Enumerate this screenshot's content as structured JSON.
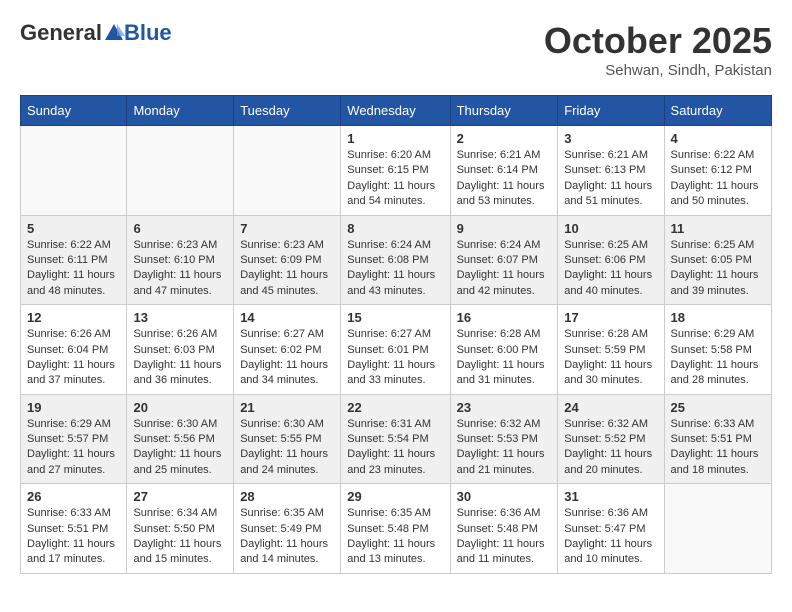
{
  "header": {
    "logo_general": "General",
    "logo_blue": "Blue",
    "month": "October 2025",
    "location": "Sehwan, Sindh, Pakistan"
  },
  "weekdays": [
    "Sunday",
    "Monday",
    "Tuesday",
    "Wednesday",
    "Thursday",
    "Friday",
    "Saturday"
  ],
  "weeks": [
    [
      {
        "day": "",
        "info": ""
      },
      {
        "day": "",
        "info": ""
      },
      {
        "day": "",
        "info": ""
      },
      {
        "day": "1",
        "info": "Sunrise: 6:20 AM\nSunset: 6:15 PM\nDaylight: 11 hours\nand 54 minutes."
      },
      {
        "day": "2",
        "info": "Sunrise: 6:21 AM\nSunset: 6:14 PM\nDaylight: 11 hours\nand 53 minutes."
      },
      {
        "day": "3",
        "info": "Sunrise: 6:21 AM\nSunset: 6:13 PM\nDaylight: 11 hours\nand 51 minutes."
      },
      {
        "day": "4",
        "info": "Sunrise: 6:22 AM\nSunset: 6:12 PM\nDaylight: 11 hours\nand 50 minutes."
      }
    ],
    [
      {
        "day": "5",
        "info": "Sunrise: 6:22 AM\nSunset: 6:11 PM\nDaylight: 11 hours\nand 48 minutes."
      },
      {
        "day": "6",
        "info": "Sunrise: 6:23 AM\nSunset: 6:10 PM\nDaylight: 11 hours\nand 47 minutes."
      },
      {
        "day": "7",
        "info": "Sunrise: 6:23 AM\nSunset: 6:09 PM\nDaylight: 11 hours\nand 45 minutes."
      },
      {
        "day": "8",
        "info": "Sunrise: 6:24 AM\nSunset: 6:08 PM\nDaylight: 11 hours\nand 43 minutes."
      },
      {
        "day": "9",
        "info": "Sunrise: 6:24 AM\nSunset: 6:07 PM\nDaylight: 11 hours\nand 42 minutes."
      },
      {
        "day": "10",
        "info": "Sunrise: 6:25 AM\nSunset: 6:06 PM\nDaylight: 11 hours\nand 40 minutes."
      },
      {
        "day": "11",
        "info": "Sunrise: 6:25 AM\nSunset: 6:05 PM\nDaylight: 11 hours\nand 39 minutes."
      }
    ],
    [
      {
        "day": "12",
        "info": "Sunrise: 6:26 AM\nSunset: 6:04 PM\nDaylight: 11 hours\nand 37 minutes."
      },
      {
        "day": "13",
        "info": "Sunrise: 6:26 AM\nSunset: 6:03 PM\nDaylight: 11 hours\nand 36 minutes."
      },
      {
        "day": "14",
        "info": "Sunrise: 6:27 AM\nSunset: 6:02 PM\nDaylight: 11 hours\nand 34 minutes."
      },
      {
        "day": "15",
        "info": "Sunrise: 6:27 AM\nSunset: 6:01 PM\nDaylight: 11 hours\nand 33 minutes."
      },
      {
        "day": "16",
        "info": "Sunrise: 6:28 AM\nSunset: 6:00 PM\nDaylight: 11 hours\nand 31 minutes."
      },
      {
        "day": "17",
        "info": "Sunrise: 6:28 AM\nSunset: 5:59 PM\nDaylight: 11 hours\nand 30 minutes."
      },
      {
        "day": "18",
        "info": "Sunrise: 6:29 AM\nSunset: 5:58 PM\nDaylight: 11 hours\nand 28 minutes."
      }
    ],
    [
      {
        "day": "19",
        "info": "Sunrise: 6:29 AM\nSunset: 5:57 PM\nDaylight: 11 hours\nand 27 minutes."
      },
      {
        "day": "20",
        "info": "Sunrise: 6:30 AM\nSunset: 5:56 PM\nDaylight: 11 hours\nand 25 minutes."
      },
      {
        "day": "21",
        "info": "Sunrise: 6:30 AM\nSunset: 5:55 PM\nDaylight: 11 hours\nand 24 minutes."
      },
      {
        "day": "22",
        "info": "Sunrise: 6:31 AM\nSunset: 5:54 PM\nDaylight: 11 hours\nand 23 minutes."
      },
      {
        "day": "23",
        "info": "Sunrise: 6:32 AM\nSunset: 5:53 PM\nDaylight: 11 hours\nand 21 minutes."
      },
      {
        "day": "24",
        "info": "Sunrise: 6:32 AM\nSunset: 5:52 PM\nDaylight: 11 hours\nand 20 minutes."
      },
      {
        "day": "25",
        "info": "Sunrise: 6:33 AM\nSunset: 5:51 PM\nDaylight: 11 hours\nand 18 minutes."
      }
    ],
    [
      {
        "day": "26",
        "info": "Sunrise: 6:33 AM\nSunset: 5:51 PM\nDaylight: 11 hours\nand 17 minutes."
      },
      {
        "day": "27",
        "info": "Sunrise: 6:34 AM\nSunset: 5:50 PM\nDaylight: 11 hours\nand 15 minutes."
      },
      {
        "day": "28",
        "info": "Sunrise: 6:35 AM\nSunset: 5:49 PM\nDaylight: 11 hours\nand 14 minutes."
      },
      {
        "day": "29",
        "info": "Sunrise: 6:35 AM\nSunset: 5:48 PM\nDaylight: 11 hours\nand 13 minutes."
      },
      {
        "day": "30",
        "info": "Sunrise: 6:36 AM\nSunset: 5:48 PM\nDaylight: 11 hours\nand 11 minutes."
      },
      {
        "day": "31",
        "info": "Sunrise: 6:36 AM\nSunset: 5:47 PM\nDaylight: 11 hours\nand 10 minutes."
      },
      {
        "day": "",
        "info": ""
      }
    ]
  ]
}
